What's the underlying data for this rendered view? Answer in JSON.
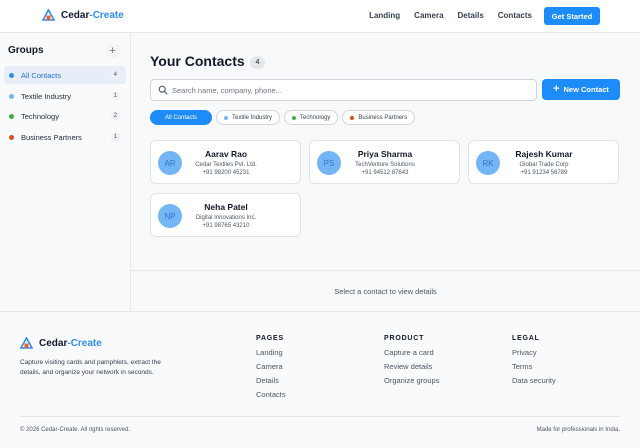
{
  "brand": {
    "name_main": "Cedar",
    "name_accent": "-Create"
  },
  "nav": {
    "links": [
      "Landing",
      "Camera",
      "Details",
      "Contacts"
    ],
    "cta_label": "Get Started"
  },
  "sidebar": {
    "title": "Groups",
    "add_label": "+",
    "groups": [
      {
        "label": "All Contacts",
        "count": "4",
        "color": "#2f8cf0"
      },
      {
        "label": "Textile Industry",
        "count": "1",
        "color": "#74b5f6"
      },
      {
        "label": "Technology",
        "count": "2",
        "color": "#3fae49"
      },
      {
        "label": "Business Partners",
        "count": "1",
        "color": "#e04e1f"
      }
    ]
  },
  "main": {
    "title": "Your Contacts",
    "count": "4",
    "search_placeholder": "Search name, company, phone...",
    "new_contact_label": "New Contact",
    "new_contact_icon": "+",
    "filters": [
      {
        "label": "All Contacts",
        "color": ""
      },
      {
        "label": "Textile Industry",
        "color": "#74b5f6"
      },
      {
        "label": "Technology",
        "color": "#3fae49"
      },
      {
        "label": "Business Partners",
        "color": "#e04e1f"
      }
    ],
    "contacts": [
      {
        "initials": "AR",
        "name": "Aarav Rao",
        "company": "Cedar Textiles Pvt. Ltd.",
        "phone": "+91 98200 45231"
      },
      {
        "initials": "PS",
        "name": "Priya Sharma",
        "company": "TechVenture Solutions",
        "phone": "+91 94512 87643"
      },
      {
        "initials": "RK",
        "name": "Rajesh Kumar",
        "company": "Global Trade Corp",
        "phone": "+91 91234 56789"
      },
      {
        "initials": "NP",
        "name": "Neha Patel",
        "company": "Digital Innovations Inc.",
        "phone": "+91 98765 43210"
      }
    ],
    "details_placeholder": "Select a contact to view details"
  },
  "footer": {
    "description": "Capture visiting cards and pamphlets, extract the details, and organize your network in seconds.",
    "columns": [
      {
        "heading": "PAGES",
        "links": [
          "Landing",
          "Camera",
          "Details",
          "Contacts"
        ]
      },
      {
        "heading": "PRODUCT",
        "links": [
          "Capture a card",
          "Review details",
          "Organize groups"
        ]
      },
      {
        "heading": "LEGAL",
        "links": [
          "Privacy",
          "Terms",
          "Data security"
        ]
      }
    ],
    "copyright": "© 2026 Cedar-Create. All rights reserved.",
    "made_in": "Made for professionals in India."
  },
  "colors": {
    "accent": "#1d8cf8",
    "logo_blue": "#2f8cf0",
    "logo_orange": "#e8632c"
  },
  "icons": {
    "logo": "cedar-logo-icon",
    "search": "search-icon",
    "plus": "plus-icon"
  }
}
